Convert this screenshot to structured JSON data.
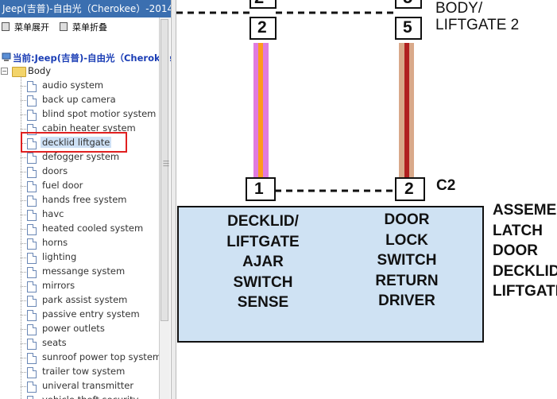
{
  "window": {
    "title": "Jeep(吉普)-自由光（Cherokee）-2014-"
  },
  "toolbar": {
    "expand_label": "菜单展开",
    "collapse_label": "菜单折叠"
  },
  "tree": {
    "root_label": "当前:Jeep(吉普)-自由光（Cherokee）",
    "folder_label": "Body",
    "selected_index": 4,
    "items": [
      "audio system",
      "back up camera",
      "blind spot motior system",
      "cabin heater system",
      "decklid liftgate",
      "defogger system",
      "doors",
      "fuel door",
      "hands free system",
      "havc",
      "heated cooled system",
      "horns",
      "lighting",
      "messange system",
      "mirrors",
      "park assist system",
      "passive entry system",
      "power outlets",
      "seats",
      "sunroof power top system",
      "trailer tow system",
      "univeral transmitter",
      "vehicle theft security"
    ]
  },
  "diagram": {
    "top_pin_left": "2",
    "top_pin_right": "5",
    "top_pin_left_partial": "2",
    "top_pin_right_partial": "5",
    "top_label_line1": "BODY/",
    "top_label_line2": "LIFTGATE 2",
    "bottom_pin_left": "1",
    "bottom_pin_right": "2",
    "connector_label": "C2",
    "box_left_lines": [
      "DECKLID/",
      "LIFTGATE",
      "AJAR",
      "SWITCH",
      "SENSE"
    ],
    "box_right_lines": [
      "DOOR",
      "LOCK",
      "SWITCH",
      "RETURN",
      "DRIVER"
    ],
    "side_label_lines": [
      "ASSEME",
      "LATCH",
      "DOOR",
      "DECKLID",
      "LIFTGATE"
    ],
    "wire_left_colors": [
      "#e07be0",
      "#ff9a1f"
    ],
    "wire_right_colors": [
      "#d9a98a",
      "#b02020"
    ],
    "box_fill": "#cfe2f3"
  }
}
